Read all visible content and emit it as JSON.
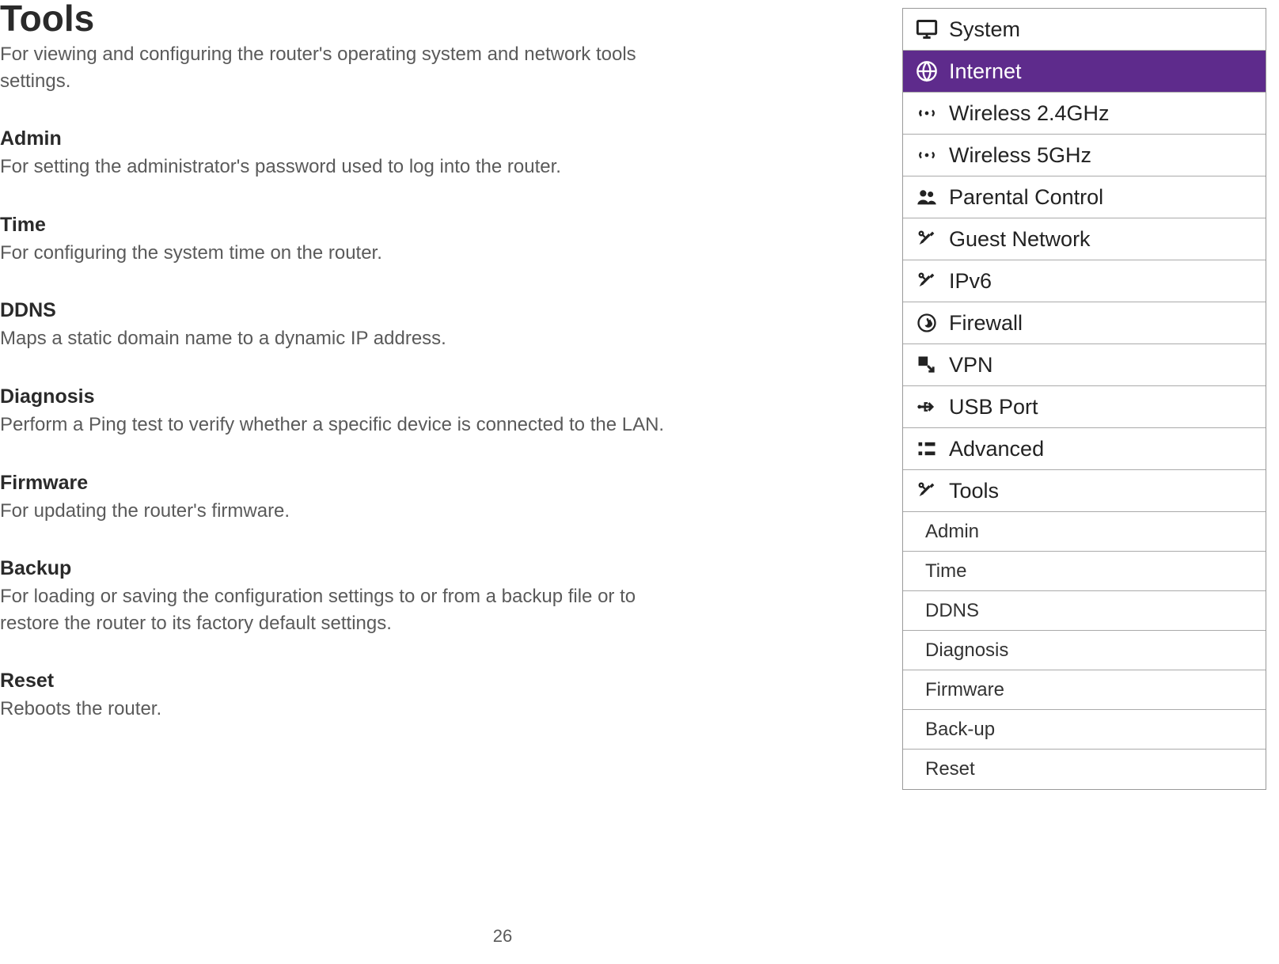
{
  "page": {
    "title": "Tools",
    "description": "For viewing and configuring the router's operating system and network tools settings.",
    "number": "26"
  },
  "sections": [
    {
      "heading": "Admin",
      "desc": "For setting the administrator's password used to log into the router."
    },
    {
      "heading": "Time",
      "desc": "For configuring the system time on the router."
    },
    {
      "heading": "DDNS",
      "desc": "Maps a static domain name to a dynamic IP address."
    },
    {
      "heading": "Diagnosis",
      "desc": "Perform a Ping test to verify whether a specific device is connected to the LAN."
    },
    {
      "heading": "Firmware",
      "desc": "For updating the router's firmware."
    },
    {
      "heading": "Backup",
      "desc": "For loading or saving the configuration settings to or from a backup file or to restore the router to its factory default settings."
    },
    {
      "heading": "Reset",
      "desc": "Reboots the router."
    }
  ],
  "menu": {
    "items": [
      {
        "label": "System",
        "icon": "monitor-icon",
        "selected": false
      },
      {
        "label": "Internet",
        "icon": "globe-icon",
        "selected": true
      },
      {
        "label": "Wireless 2.4GHz",
        "icon": "wifi-icon",
        "selected": false
      },
      {
        "label": "Wireless 5GHz",
        "icon": "wifi-icon",
        "selected": false
      },
      {
        "label": "Parental Control",
        "icon": "users-icon",
        "selected": false
      },
      {
        "label": "Guest Network",
        "icon": "tools-icon",
        "selected": false
      },
      {
        "label": "IPv6",
        "icon": "tools-icon",
        "selected": false
      },
      {
        "label": "Firewall",
        "icon": "fire-icon",
        "selected": false
      },
      {
        "label": "VPN",
        "icon": "arrow-icon",
        "selected": false
      },
      {
        "label": "USB Port",
        "icon": "usb-icon",
        "selected": false
      },
      {
        "label": "Advanced",
        "icon": "list-icon",
        "selected": false
      },
      {
        "label": "Tools",
        "icon": "tools-icon",
        "selected": false
      }
    ],
    "subitems": [
      {
        "label": "Admin"
      },
      {
        "label": "Time"
      },
      {
        "label": "DDNS"
      },
      {
        "label": "Diagnosis"
      },
      {
        "label": "Firmware"
      },
      {
        "label": "Back-up"
      },
      {
        "label": "Reset"
      }
    ]
  }
}
